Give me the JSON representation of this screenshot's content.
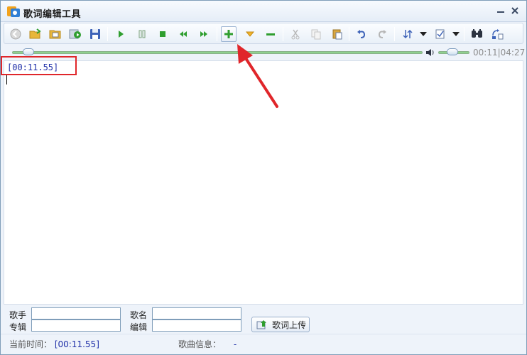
{
  "window": {
    "title": "歌词编辑工具"
  },
  "toolbar": {
    "buttons": [
      "back-icon",
      "open-folder-icon",
      "open-file-icon",
      "play-export-icon",
      "save-icon",
      "play-icon",
      "pause-icon",
      "stop-icon",
      "rewind-icon",
      "fast-forward-icon",
      "add-tag-icon",
      "insert-down-icon",
      "remove-tag-icon",
      "cut-icon",
      "copy-icon",
      "paste-icon",
      "undo-icon",
      "redo-icon",
      "sort-icon",
      "check-icon",
      "find-icon",
      "replace-icon"
    ]
  },
  "player": {
    "progress": 0.04,
    "volume": 0.45,
    "current_time": "00:11",
    "separator": "|",
    "total_time": "04:27"
  },
  "editor": {
    "lines": [
      "[00:11.55]"
    ]
  },
  "meta": {
    "singer_label": "歌手",
    "album_label": "专辑",
    "song_label": "歌名",
    "editor_label": "编辑",
    "singer_value": "",
    "album_value": "",
    "song_value": "",
    "editor_value": "",
    "upload_label": "歌词上传"
  },
  "status": {
    "current_time_label": "当前时间：",
    "current_time_value": "[00:11.55]",
    "song_info_label": "歌曲信息：",
    "song_info_value": "-"
  },
  "colors": {
    "highlight": "#e0262a",
    "lyric_text": "#1f2fa8",
    "accent_green": "#2f9e2f"
  }
}
